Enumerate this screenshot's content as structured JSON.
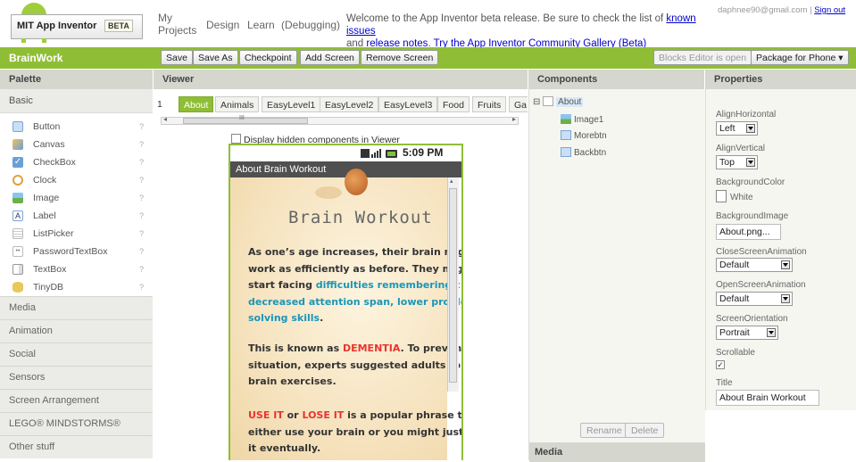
{
  "header": {
    "logo_title": "MIT App Inventor",
    "beta_badge": "BETA",
    "nav": {
      "my_projects_1": "My",
      "my_projects_2": "Projects",
      "design": "Design",
      "learn": "Learn",
      "debugging": "(Debugging)"
    },
    "welcome_prefix": "Welcome to the App Inventor beta release. Be sure to check the list of ",
    "known_issues": "known issues",
    "and": "and ",
    "release_notes": "release notes",
    "period": ". ",
    "gallery_link": "Try the App Inventor Community Gallery (Beta)",
    "user_email": "daphnee90@gmail.com",
    "separator": "|",
    "sign_out": "Sign out"
  },
  "toolbar": {
    "project_name": "BrainWork",
    "save": "Save",
    "save_as": "Save As",
    "checkpoint": "Checkpoint",
    "add_screen": "Add Screen",
    "remove_screen": "Remove Screen",
    "blocks_editor": "Blocks Editor is open",
    "package": "Package for Phone ▾"
  },
  "columns": {
    "palette": "Palette",
    "viewer": "Viewer",
    "components": "Components",
    "properties": "Properties"
  },
  "palette": {
    "basic_label": "Basic",
    "items": [
      {
        "label": "Button",
        "help": "?"
      },
      {
        "label": "Canvas",
        "help": "?"
      },
      {
        "label": "CheckBox",
        "help": "?"
      },
      {
        "label": "Clock",
        "help": "?"
      },
      {
        "label": "Image",
        "help": "?"
      },
      {
        "label": "Label",
        "help": "?"
      },
      {
        "label": "ListPicker",
        "help": "?"
      },
      {
        "label": "PasswordTextBox",
        "help": "?"
      },
      {
        "label": "TextBox",
        "help": "?"
      },
      {
        "label": "TinyDB",
        "help": "?"
      }
    ],
    "categories": [
      "Media",
      "Animation",
      "Social",
      "Sensors",
      "Screen Arrangement",
      "LEGO® MINDSTORMS®",
      "Other stuff"
    ]
  },
  "viewer": {
    "screen_tabs": [
      "1",
      "About",
      "Animals",
      "EasyLevel1",
      "EasyLevel2",
      "EasyLevel3",
      "Food",
      "Fruits",
      "Ga"
    ],
    "active_tab": "About",
    "hscroll_grip": "III",
    "display_hidden": "Display hidden components in Viewer",
    "status_time": "5:09 PM",
    "app_title": "About Brain Workout",
    "brain_title": "Brain Workout",
    "p1": [
      "As one’s age increases, their brain mig",
      "work as efficiently as before. They mig",
      "start facing "
    ],
    "p1_blue": [
      "difficulties remembering t",
      "decreased attention span, lower proble",
      "solving skills"
    ],
    "p2_a": "This is known as ",
    "p2_red": "DEMENTIA",
    "p2_b": ". To preven",
    "p2_lines": [
      "situation, experts suggested adults to p",
      "brain exercises."
    ],
    "p3_use": "USE IT",
    "p3_or": " or ",
    "p3_lose": "LOSE IT",
    "p3_rest": " is a popular phrase t",
    "p3_lines": [
      "either use your brain or you might just",
      "it eventually."
    ]
  },
  "components": {
    "tree": [
      {
        "label": "About",
        "expander": "⊟"
      },
      {
        "label": "Image1"
      },
      {
        "label": "Morebtn"
      },
      {
        "label": "Backbtn"
      }
    ],
    "rename": "Rename",
    "delete": "Delete",
    "media": "Media"
  },
  "properties": {
    "align_h_label": "AlignHorizontal",
    "align_h_value": "Left",
    "align_v_label": "AlignVertical",
    "align_v_value": "Top",
    "bg_color_label": "BackgroundColor",
    "bg_color_value": "White",
    "bg_image_label": "BackgroundImage",
    "bg_image_value": "About.png...",
    "close_anim_label": "CloseScreenAnimation",
    "close_anim_value": "Default",
    "open_anim_label": "OpenScreenAnimation",
    "open_anim_value": "Default",
    "orientation_label": "ScreenOrientation",
    "orientation_value": "Portrait",
    "scrollable_label": "Scrollable",
    "scrollable_checked": "✓",
    "title_label": "Title",
    "title_value": "About Brain Workout"
  },
  "colors": {
    "accent": "#8fbe36",
    "column_header": "#d5d7cf",
    "link": "#0000cc",
    "dementia": "#e8352e",
    "highlight": "#1a96b8"
  }
}
